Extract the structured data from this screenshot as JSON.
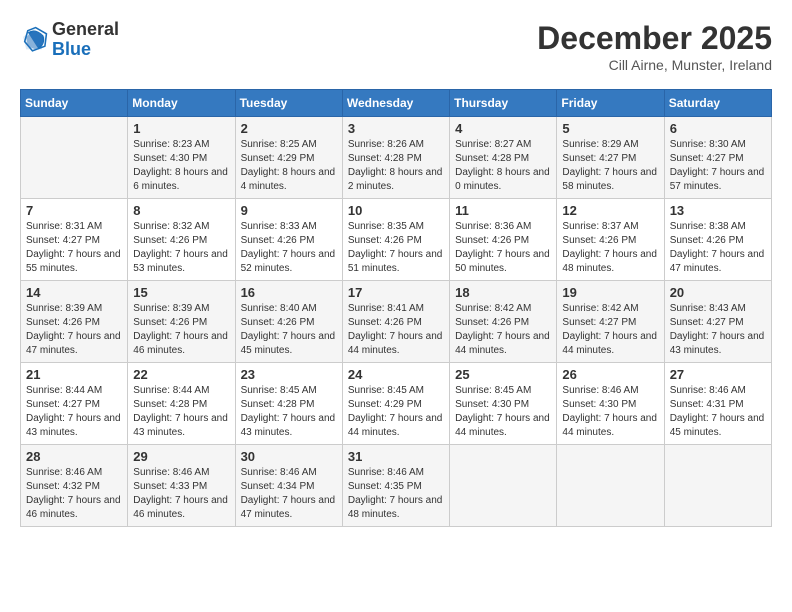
{
  "header": {
    "logo_general": "General",
    "logo_blue": "Blue",
    "month_title": "December 2025",
    "location": "Cill Airne, Munster, Ireland"
  },
  "days_of_week": [
    "Sunday",
    "Monday",
    "Tuesday",
    "Wednesday",
    "Thursday",
    "Friday",
    "Saturday"
  ],
  "weeks": [
    [
      {
        "day": "",
        "sunrise": "",
        "sunset": "",
        "daylight": ""
      },
      {
        "day": "1",
        "sunrise": "Sunrise: 8:23 AM",
        "sunset": "Sunset: 4:30 PM",
        "daylight": "Daylight: 8 hours and 6 minutes."
      },
      {
        "day": "2",
        "sunrise": "Sunrise: 8:25 AM",
        "sunset": "Sunset: 4:29 PM",
        "daylight": "Daylight: 8 hours and 4 minutes."
      },
      {
        "day": "3",
        "sunrise": "Sunrise: 8:26 AM",
        "sunset": "Sunset: 4:28 PM",
        "daylight": "Daylight: 8 hours and 2 minutes."
      },
      {
        "day": "4",
        "sunrise": "Sunrise: 8:27 AM",
        "sunset": "Sunset: 4:28 PM",
        "daylight": "Daylight: 8 hours and 0 minutes."
      },
      {
        "day": "5",
        "sunrise": "Sunrise: 8:29 AM",
        "sunset": "Sunset: 4:27 PM",
        "daylight": "Daylight: 7 hours and 58 minutes."
      },
      {
        "day": "6",
        "sunrise": "Sunrise: 8:30 AM",
        "sunset": "Sunset: 4:27 PM",
        "daylight": "Daylight: 7 hours and 57 minutes."
      }
    ],
    [
      {
        "day": "7",
        "sunrise": "Sunrise: 8:31 AM",
        "sunset": "Sunset: 4:27 PM",
        "daylight": "Daylight: 7 hours and 55 minutes."
      },
      {
        "day": "8",
        "sunrise": "Sunrise: 8:32 AM",
        "sunset": "Sunset: 4:26 PM",
        "daylight": "Daylight: 7 hours and 53 minutes."
      },
      {
        "day": "9",
        "sunrise": "Sunrise: 8:33 AM",
        "sunset": "Sunset: 4:26 PM",
        "daylight": "Daylight: 7 hours and 52 minutes."
      },
      {
        "day": "10",
        "sunrise": "Sunrise: 8:35 AM",
        "sunset": "Sunset: 4:26 PM",
        "daylight": "Daylight: 7 hours and 51 minutes."
      },
      {
        "day": "11",
        "sunrise": "Sunrise: 8:36 AM",
        "sunset": "Sunset: 4:26 PM",
        "daylight": "Daylight: 7 hours and 50 minutes."
      },
      {
        "day": "12",
        "sunrise": "Sunrise: 8:37 AM",
        "sunset": "Sunset: 4:26 PM",
        "daylight": "Daylight: 7 hours and 48 minutes."
      },
      {
        "day": "13",
        "sunrise": "Sunrise: 8:38 AM",
        "sunset": "Sunset: 4:26 PM",
        "daylight": "Daylight: 7 hours and 47 minutes."
      }
    ],
    [
      {
        "day": "14",
        "sunrise": "Sunrise: 8:39 AM",
        "sunset": "Sunset: 4:26 PM",
        "daylight": "Daylight: 7 hours and 47 minutes."
      },
      {
        "day": "15",
        "sunrise": "Sunrise: 8:39 AM",
        "sunset": "Sunset: 4:26 PM",
        "daylight": "Daylight: 7 hours and 46 minutes."
      },
      {
        "day": "16",
        "sunrise": "Sunrise: 8:40 AM",
        "sunset": "Sunset: 4:26 PM",
        "daylight": "Daylight: 7 hours and 45 minutes."
      },
      {
        "day": "17",
        "sunrise": "Sunrise: 8:41 AM",
        "sunset": "Sunset: 4:26 PM",
        "daylight": "Daylight: 7 hours and 44 minutes."
      },
      {
        "day": "18",
        "sunrise": "Sunrise: 8:42 AM",
        "sunset": "Sunset: 4:26 PM",
        "daylight": "Daylight: 7 hours and 44 minutes."
      },
      {
        "day": "19",
        "sunrise": "Sunrise: 8:42 AM",
        "sunset": "Sunset: 4:27 PM",
        "daylight": "Daylight: 7 hours and 44 minutes."
      },
      {
        "day": "20",
        "sunrise": "Sunrise: 8:43 AM",
        "sunset": "Sunset: 4:27 PM",
        "daylight": "Daylight: 7 hours and 43 minutes."
      }
    ],
    [
      {
        "day": "21",
        "sunrise": "Sunrise: 8:44 AM",
        "sunset": "Sunset: 4:27 PM",
        "daylight": "Daylight: 7 hours and 43 minutes."
      },
      {
        "day": "22",
        "sunrise": "Sunrise: 8:44 AM",
        "sunset": "Sunset: 4:28 PM",
        "daylight": "Daylight: 7 hours and 43 minutes."
      },
      {
        "day": "23",
        "sunrise": "Sunrise: 8:45 AM",
        "sunset": "Sunset: 4:28 PM",
        "daylight": "Daylight: 7 hours and 43 minutes."
      },
      {
        "day": "24",
        "sunrise": "Sunrise: 8:45 AM",
        "sunset": "Sunset: 4:29 PM",
        "daylight": "Daylight: 7 hours and 44 minutes."
      },
      {
        "day": "25",
        "sunrise": "Sunrise: 8:45 AM",
        "sunset": "Sunset: 4:30 PM",
        "daylight": "Daylight: 7 hours and 44 minutes."
      },
      {
        "day": "26",
        "sunrise": "Sunrise: 8:46 AM",
        "sunset": "Sunset: 4:30 PM",
        "daylight": "Daylight: 7 hours and 44 minutes."
      },
      {
        "day": "27",
        "sunrise": "Sunrise: 8:46 AM",
        "sunset": "Sunset: 4:31 PM",
        "daylight": "Daylight: 7 hours and 45 minutes."
      }
    ],
    [
      {
        "day": "28",
        "sunrise": "Sunrise: 8:46 AM",
        "sunset": "Sunset: 4:32 PM",
        "daylight": "Daylight: 7 hours and 46 minutes."
      },
      {
        "day": "29",
        "sunrise": "Sunrise: 8:46 AM",
        "sunset": "Sunset: 4:33 PM",
        "daylight": "Daylight: 7 hours and 46 minutes."
      },
      {
        "day": "30",
        "sunrise": "Sunrise: 8:46 AM",
        "sunset": "Sunset: 4:34 PM",
        "daylight": "Daylight: 7 hours and 47 minutes."
      },
      {
        "day": "31",
        "sunrise": "Sunrise: 8:46 AM",
        "sunset": "Sunset: 4:35 PM",
        "daylight": "Daylight: 7 hours and 48 minutes."
      },
      {
        "day": "",
        "sunrise": "",
        "sunset": "",
        "daylight": ""
      },
      {
        "day": "",
        "sunrise": "",
        "sunset": "",
        "daylight": ""
      },
      {
        "day": "",
        "sunrise": "",
        "sunset": "",
        "daylight": ""
      }
    ]
  ]
}
